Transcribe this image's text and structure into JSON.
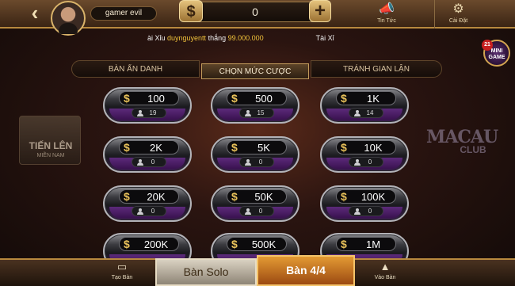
{
  "header": {
    "back_icon": "‹",
    "username": "gamer evil",
    "balance": "0",
    "currency_symbol": "$",
    "add_symbol": "+",
    "news_label": "Tin Tức",
    "settings_label": "Cài Đặt"
  },
  "marquee": {
    "prefix": "ài Xỉu ",
    "winner": "duynguyentt",
    "middle": " thắng ",
    "amount": "99.000.000",
    "suffix": "Tài Xỉ"
  },
  "mini_game": {
    "label_line1": "MINI",
    "label_line2": "GAME",
    "badge": "21"
  },
  "tabs": {
    "anonymous": "BÀN ẨN DANH",
    "select_bet": "CHỌN MỨC CƯỢC",
    "anti_cheat": "TRÁNH GIAN LẬN"
  },
  "side": {
    "tien_len_title": "TIẾN LÊN",
    "tien_len_sub": "MIỀN NAM",
    "macau_1": "MACAU",
    "macau_2": "CLUB"
  },
  "tables": [
    {
      "bet": "100",
      "players": "19"
    },
    {
      "bet": "500",
      "players": "15"
    },
    {
      "bet": "1K",
      "players": "14"
    },
    {
      "bet": "2K",
      "players": "0"
    },
    {
      "bet": "5K",
      "players": "0"
    },
    {
      "bet": "10K",
      "players": "0"
    },
    {
      "bet": "20K",
      "players": "0"
    },
    {
      "bet": "50K",
      "players": "0"
    },
    {
      "bet": "100K",
      "players": "0"
    },
    {
      "bet": "200K",
      "players": ""
    },
    {
      "bet": "500K",
      "players": ""
    },
    {
      "bet": "1M",
      "players": ""
    }
  ],
  "footer": {
    "create_label": "Tạo Bàn",
    "solo_label": "Bàn Solo",
    "four_label": "Bàn 4/4",
    "join_label": "Vào Bàn"
  }
}
